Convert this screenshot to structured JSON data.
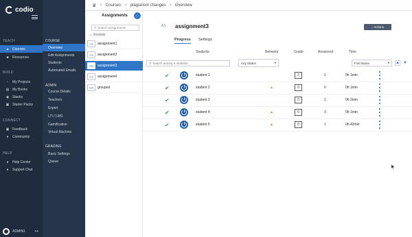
{
  "nav": {
    "brand": "codio",
    "sections": [
      {
        "key": "teach",
        "label": "TEACH"
      },
      {
        "key": "build",
        "label": "BUILD"
      },
      {
        "key": "connect",
        "label": "CONNECT"
      },
      {
        "key": "help",
        "label": "HELP"
      }
    ],
    "items": [
      {
        "label": "Courses",
        "icon": "graduation-icon"
      },
      {
        "label": "Resources",
        "icon": "folder-icon"
      },
      {
        "label": "My Projects",
        "icon": "file-icon"
      },
      {
        "label": "My Books",
        "icon": "book-icon"
      },
      {
        "label": "Stacks",
        "icon": "stack-icon"
      },
      {
        "label": "Starter Packs",
        "icon": "box-icon"
      },
      {
        "label": "Feedback",
        "icon": "chat-icon"
      },
      {
        "label": "Community",
        "icon": "people-icon"
      },
      {
        "label": "Help Center",
        "icon": "question-icon"
      },
      {
        "label": "Support Chat",
        "icon": "support-icon"
      }
    ],
    "user": "ADMIN1"
  },
  "subnav": {
    "sections": [
      "COURSE",
      "ADMIN",
      "GRADING"
    ],
    "course_items": [
      "Overview",
      "Edit Assignments",
      "Students",
      "Automated Emails"
    ],
    "admin_items": [
      "Course Details",
      "Teachers",
      "Export",
      "LTI / LMS",
      "Gamification",
      "Virtual Machine"
    ],
    "grading_items": [
      "Basic Settings",
      "Queue"
    ]
  },
  "breadcrumb": {
    "home_icon": "home-icon",
    "items": [
      "Courses",
      "plagiarism changes",
      "Overview"
    ],
    "separator": ">"
  },
  "assignments": {
    "title": "Assignments",
    "search_placeholder": "Search assignments",
    "module": "/module",
    "rows": [
      {
        "badge": "AS",
        "name": "assignment1"
      },
      {
        "badge": "AS",
        "name": "assignment2"
      },
      {
        "badge": "AS",
        "name": "assignment3"
      },
      {
        "badge": "AS",
        "name": "assignment4"
      },
      {
        "badge": "GR",
        "name": "grouped"
      }
    ]
  },
  "main": {
    "badge": "AS",
    "title": "assignment3",
    "actions_label": "↓ Actions",
    "tabs": [
      "Progress",
      "Settings"
    ],
    "columns": {
      "students": "Students",
      "behavior": "Behavior",
      "grade": "Grade",
      "answered": "Answered",
      "time": "Time"
    },
    "student_search_placeholder": "Search among 5 students",
    "status_filter": "Any Status",
    "sort_select": "First Name",
    "students": [
      {
        "name": "student 1",
        "behavior": "",
        "grade": "2",
        "answered": "1",
        "time": "0h 1min"
      },
      {
        "name": "student 2",
        "behavior": "▲",
        "grade": "0",
        "answered": "0",
        "time": "0h 1min"
      },
      {
        "name": "student 3",
        "behavior": "",
        "grade": "0",
        "answered": "1",
        "time": "0h 2min"
      },
      {
        "name": "student 4",
        "behavior": "▲",
        "grade": "6",
        "answered": "3",
        "time": "0h 1min"
      },
      {
        "name": "student 5",
        "behavior": "▲",
        "grade": "0",
        "answered": "1",
        "time": "0h 42min"
      }
    ]
  },
  "colors": {
    "accent": "#2f76c9",
    "nav_bg": "#1f2c3d",
    "sub_bg": "#263549",
    "ok": "#2fa65a",
    "behavior": "#e8772e"
  }
}
